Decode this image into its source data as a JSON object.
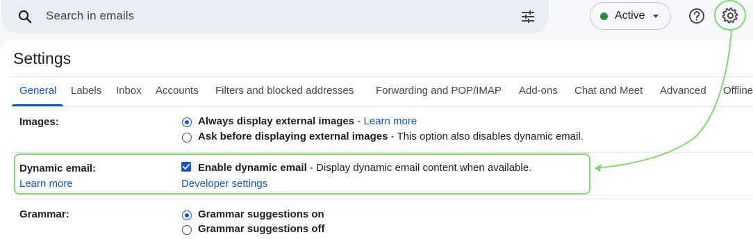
{
  "search": {
    "placeholder": "Search in emails"
  },
  "status": {
    "label": "Active",
    "color": "#1e8e3e"
  },
  "icons": {
    "search": "search-icon",
    "tune": "tune-icon",
    "caret": "caret-down-icon",
    "help": "help-icon",
    "settings": "gear-icon"
  },
  "page": {
    "title": "Settings"
  },
  "tabs": [
    {
      "label": "General",
      "active": true
    },
    {
      "label": "Labels"
    },
    {
      "label": "Inbox"
    },
    {
      "label": "Accounts"
    },
    {
      "label": "Filters and blocked addresses"
    },
    {
      "label": "Forwarding and POP/IMAP"
    },
    {
      "label": "Add-ons"
    },
    {
      "label": "Chat and Meet"
    },
    {
      "label": "Advanced"
    },
    {
      "label": "Offline"
    }
  ],
  "settings": {
    "images": {
      "label": "Images:",
      "options": [
        {
          "bold": "Always display external images",
          "sep": " - ",
          "link": "Learn more",
          "selected": true
        },
        {
          "bold": "Ask before displaying external images",
          "sep": " - ",
          "text": "This option also disables dynamic email.",
          "selected": false
        }
      ]
    },
    "dynamic": {
      "label": "Dynamic email:",
      "learn_more": "Learn more",
      "checkbox_bold": "Enable dynamic email",
      "sep": " - ",
      "checkbox_text": "Display dynamic email content when available.",
      "checked": true,
      "developer_link": "Developer settings"
    },
    "grammar": {
      "label": "Grammar:",
      "options": [
        {
          "bold": "Grammar suggestions on",
          "selected": true
        },
        {
          "bold": "Grammar suggestions off",
          "selected": false
        }
      ]
    }
  },
  "colors": {
    "accent": "#0b57d0",
    "annotation": "#7ddb6a"
  }
}
